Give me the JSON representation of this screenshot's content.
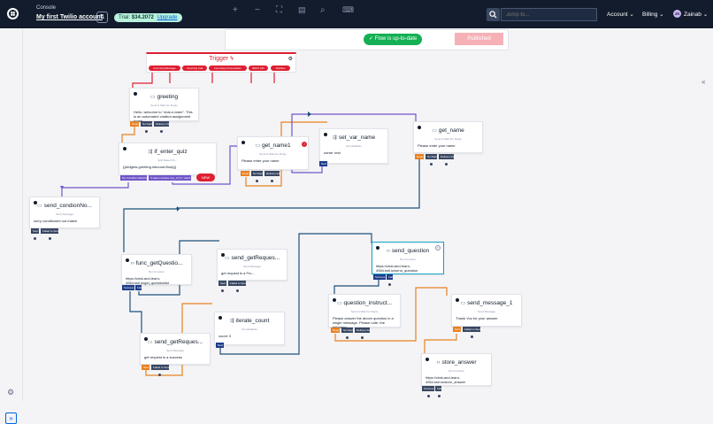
{
  "header": {
    "console_label": "Console",
    "account_name": "My first Twilio account",
    "trial_label": "Trial:",
    "trial_amount": "$34.2072",
    "upgrade_label": "Upgrade",
    "search_placeholder": "Jump to...",
    "account_menu": "Account",
    "billing_menu": "Billing",
    "user_initials": "ZR",
    "user_name": "Zainab"
  },
  "toolbar": {
    "status_label": "Flow is up-to-date",
    "publish_label": "Published"
  },
  "trigger": {
    "title": "Trigger",
    "ports": [
      "Incoming Message",
      "Incoming Call",
      "Incoming Conversation",
      "REST API",
      "Subflow"
    ]
  },
  "widgets": {
    "greeting": {
      "title": "greeting",
      "subtitle": "Send & Wait For Reply",
      "body": "Hello, welcome to \"chat-n-learn\". This is an automated chatbot assignment portal",
      "ports": [
        "Reply",
        "No Reply",
        "Delivery Fail"
      ]
    },
    "if_enter_quiz": {
      "title": "if_enter_quiz",
      "subtitle": "Split Based On...",
      "body": "{{widgets.greeting.inbound.Body}}",
      "ports": [
        "No Condition Matches",
        "If value includes any_of ['1', 'start']"
      ],
      "new_label": "NEW"
    },
    "get_name1": {
      "title": "get_name1",
      "subtitle": "Send & Wait For Reply",
      "body": "Please enter your name",
      "ports": [
        "Reply",
        "No Reply",
        "Delivery Fail"
      ]
    },
    "set_var_name": {
      "title": "set_var_name",
      "subtitle": "Set Variables",
      "body": "name: test",
      "ports": [
        "Next"
      ]
    },
    "get_name": {
      "title": "get_name",
      "subtitle": "Send & Wait For Reply",
      "body": "Please enter your name",
      "ports": [
        "Reply",
        "No Reply",
        "Delivery Fail"
      ]
    },
    "send_condionNo": {
      "title": "send_condionNo...",
      "subtitle": "Send Message",
      "body": "sorry conditioned not match",
      "ports": [
        "Sent",
        "Failed to Send"
      ]
    },
    "func_getQuestio": {
      "title": "func_getQuestio...",
      "subtitle": "Run Function",
      "body": "https://chat-and-learn-4964.twil.io/get_questionlist",
      "ports": [
        "Success",
        "Fail"
      ]
    },
    "send_getReques1": {
      "title": "send_getReques...",
      "subtitle": "Send Message",
      "body": "get request is a Fru...",
      "ports": [
        "Sent",
        "Failed to Send"
      ]
    },
    "iterate_count": {
      "title": "iterate_count",
      "subtitle": "Set Variables",
      "body": "count: 0",
      "ports": [
        "Next"
      ]
    },
    "send_getReques2": {
      "title": "send_getReques...",
      "subtitle": "Send Message",
      "body": "get request is a success",
      "ports": [
        "Sent",
        "Failed to Send"
      ]
    },
    "send_question": {
      "title": "send_question",
      "subtitle": "Run Function",
      "body": "https://chat-and-learn-4964.twil.io/send_question",
      "ports": [
        "Success",
        "Fail"
      ]
    },
    "question_instruct": {
      "title": "question_instruct...",
      "subtitle": "Send & Wait For Reply",
      "body": "Please answer the above question in a single message. Please note, the following",
      "ports": [
        "Reply",
        "No Reply",
        "Delivery Fail"
      ]
    },
    "send_message_1": {
      "title": "send_message_1",
      "subtitle": "Send Message",
      "body": "Thank You for your answer",
      "ports": [
        "Sent",
        "Failed to Send"
      ]
    },
    "store_answer": {
      "title": "store_answer",
      "subtitle": "Run Function",
      "body": "https://chat-and-learn-4964.twil.io/store_answer",
      "ports": [
        "Success",
        "Fail"
      ]
    }
  },
  "colors": {
    "topbar": "#121c2d",
    "trigger_red": "#de1f32",
    "orange_wire": "#e8811f",
    "navy_wire": "#1f4f7a",
    "purple_wire": "#6f55c9",
    "success_green": "#14b053"
  }
}
